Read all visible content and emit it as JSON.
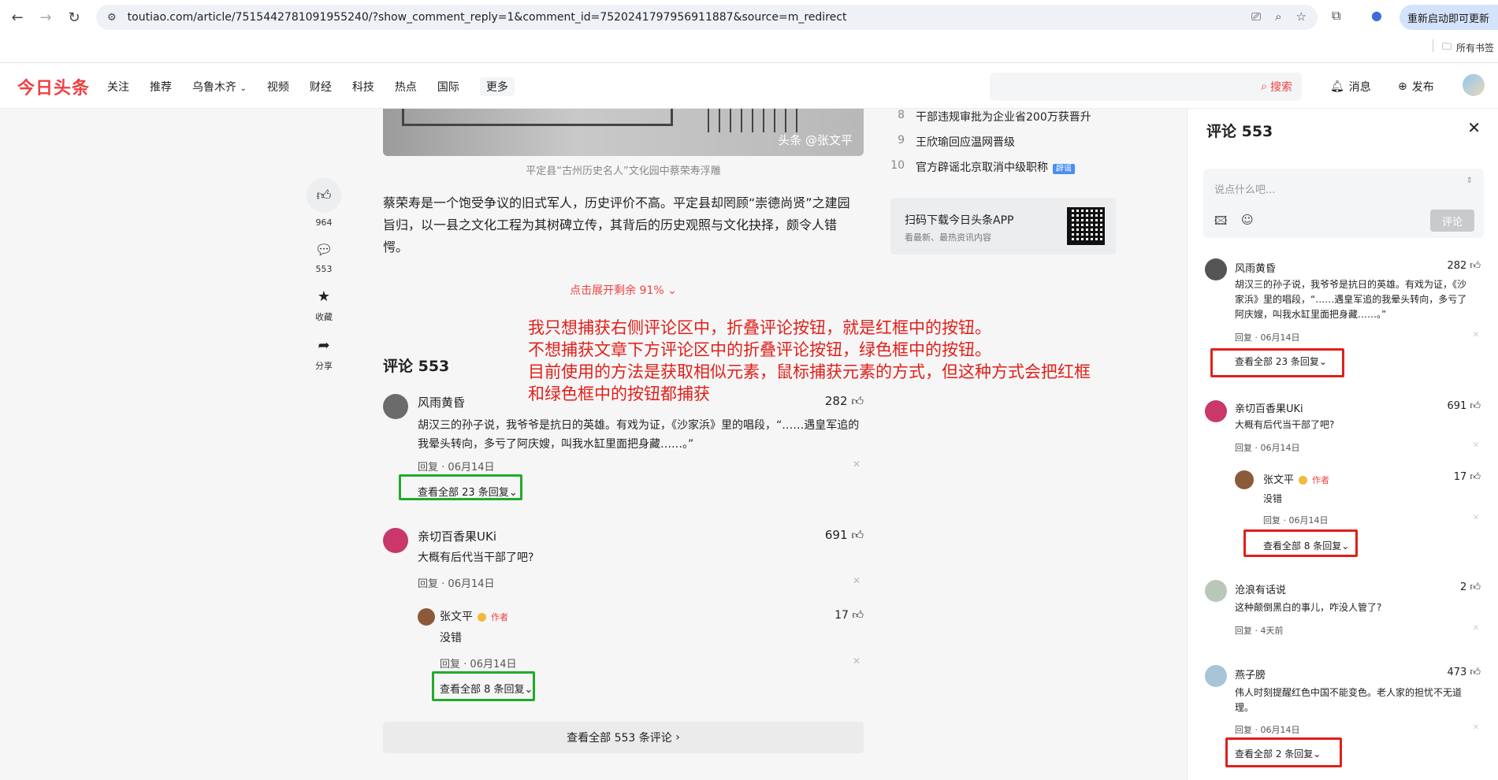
{
  "browser": {
    "url": "toutiao.com/article/7515442781091955240/?show_comment_reply=1&comment_id=7520241797956911887&source=m_redirect",
    "restart_label": "重新启动即可更新",
    "bookmarks_label": "所有书签"
  },
  "header": {
    "logo": "今日头条",
    "nav": [
      "关注",
      "推荐",
      "乌鲁木齐",
      "视频",
      "财经",
      "科技",
      "热点",
      "国际",
      "更多"
    ],
    "search_label": "搜索",
    "messages_label": "消息",
    "publish_label": "发布"
  },
  "actions": {
    "likes": "964",
    "comments": "553",
    "favorite": "收藏",
    "share": "分享"
  },
  "article": {
    "watermark": "头条 @张文平",
    "caption": "平定县“古州历史名人”文化园中蔡荣寿浮雕",
    "paragraph": "蔡荣寿是一个饱受争议的旧式军人，历史评价不高。平定县却罔顾“崇德尚贤”之建园旨归，以一县之文化工程为其树碑立传，其背后的历史观照与文化抉择，颇令人错愕。",
    "expand_label": "点击展开剩余 91%"
  },
  "annotation": {
    "lines": [
      "我只想捕获右侧评论区中，折叠评论按钮，就是红框中的按钮。",
      "不想捕获文章下方评论区中的折叠评论按钮，绿色框中的按钮。",
      "目前使用的方法是获取相似元素，鼠标捕获元素的方式，但这种方式会把红框",
      "和绿色框中的按钮都捕获"
    ]
  },
  "lower_comments": {
    "title": "评论 553",
    "items": [
      {
        "name": "风雨黄昏",
        "likes": "282",
        "text": "胡汉三的孙子说，我爷爷是抗日的英雄。有戏为证，《沙家浜》里的唱段，“……遇皇军追的我晕头转向，多亏了阿庆嫂，叫我水缸里面把身藏……。”",
        "reply": "回复",
        "date": "06月14日",
        "more": "查看全部 23 条回复"
      },
      {
        "name": "亲切百香果UKi",
        "likes": "691",
        "text": "大概有后代当干部了吧?",
        "reply": "回复",
        "date": "06月14日"
      }
    ],
    "sub_reply": {
      "name": "张文平",
      "author_tag": "作者",
      "likes": "17",
      "text": "没错",
      "reply": "回复",
      "date": "06月14日",
      "more": "查看全部 8 条回复"
    },
    "all_label": "查看全部 553 条评论"
  },
  "hot_list": [
    {
      "num": "8",
      "title": "干部违规审批为企业省200万获晋升",
      "tag": ""
    },
    {
      "num": "9",
      "title": "王欣瑜回应温网晋级",
      "tag": ""
    },
    {
      "num": "10",
      "title": "官方辟谣北京取消中级职称",
      "tag": "辟谣"
    }
  ],
  "app_box": {
    "title": "扫码下载今日头条APP",
    "subtitle": "看最新、最热资讯内容"
  },
  "panel": {
    "title": "评论 553",
    "placeholder": "说点什么吧...",
    "submit_label": "评论",
    "comments": [
      {
        "name": "风雨黄昏",
        "likes": "282",
        "text": "胡汉三的孙子说，我爷爷是抗日的英雄。有戏为证，《沙家浜》里的唱段，“……遇皇军追的我晕头转向，多亏了阿庆嫂，叫我水缸里面把身藏……。”",
        "reply": "回复",
        "date": "06月14日",
        "more": "查看全部 23 条回复"
      },
      {
        "name": "亲切百香果UKi",
        "likes": "691",
        "text": "大概有后代当干部了吧?",
        "reply": "回复",
        "date": "06月14日"
      },
      {
        "name": "沧浪有话说",
        "likes": "2",
        "text": "这种颠倒黑白的事儿，咋没人管了?",
        "reply": "回复",
        "date": "4天前"
      },
      {
        "name": "燕子膀",
        "likes": "473",
        "text": "伟人时刻提醒红色中国不能变色。老人家的担忧不无道理。",
        "reply": "回复",
        "date": "06月14日",
        "more": "查看全部 2 条回复"
      }
    ],
    "sub_reply": {
      "name": "张文平",
      "author_tag": "作者",
      "likes": "17",
      "text": "没错",
      "reply": "回复",
      "date": "06月14日",
      "more": "查看全部 8 条回复"
    }
  },
  "colors": {
    "brand_red": "#f04142",
    "annotation_red": "#e0201a",
    "green_box": "#1fab2c"
  }
}
